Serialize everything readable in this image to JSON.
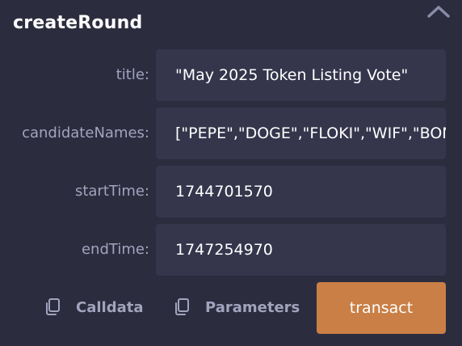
{
  "function": {
    "name": "createRound"
  },
  "fields": [
    {
      "label": "title:",
      "value": "\"May 2025 Token Listing Vote\""
    },
    {
      "label": "candidateNames:",
      "value": "[\"PEPE\",\"DOGE\",\"FLOKI\",\"WIF\",\"BONK\"]"
    },
    {
      "label": "startTime:",
      "value": "1744701570"
    },
    {
      "label": "endTime:",
      "value": "1747254970"
    }
  ],
  "actions": {
    "calldata_label": "Calldata",
    "parameters_label": "Parameters",
    "transact_label": "transact"
  },
  "icons": {
    "collapse": "chevron-up-icon",
    "calldata": "copy-icon",
    "parameters": "copy-icon"
  },
  "colors": {
    "background": "#2c2c3f",
    "field_background": "#35364c",
    "label": "#a2a3bd",
    "accent": "#c97f46",
    "text": "#ffffff"
  }
}
